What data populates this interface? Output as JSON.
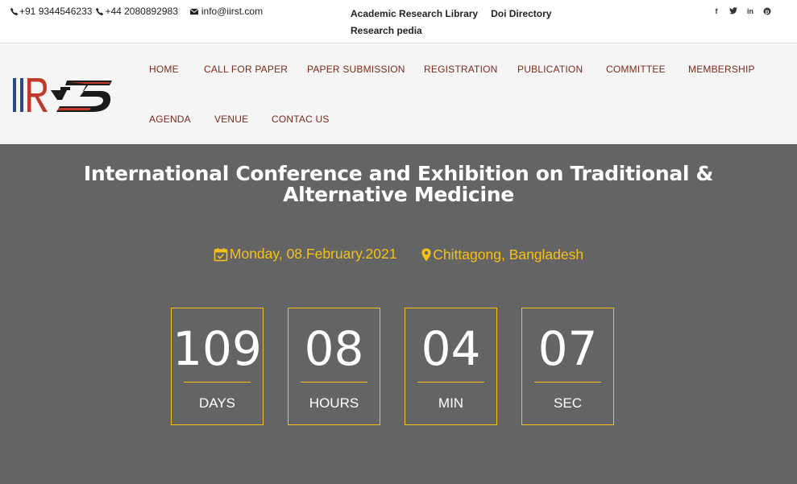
{
  "topbar": {
    "phone1": "+91 9344546233",
    "phone2": "+44 2080892983",
    "email": "info@iirst.com",
    "links": [
      "Academic Research Library",
      "Doi Directory",
      "Research pedia"
    ],
    "social": [
      "f",
      "t",
      "in",
      "p"
    ]
  },
  "nav": {
    "items": [
      "HOME",
      "CALL FOR PAPER",
      "PAPER SUBMISSION",
      "REGISTRATION",
      "PUBLICATION",
      "COMMITTEE",
      "MEMBERSHIP",
      "AGENDA",
      "VENUE",
      "CONTAC US"
    ]
  },
  "hero": {
    "title": "International Conference and Exhibition on Traditional & Alternative Medicine",
    "date": "Monday, 08.February.2021",
    "location": "Chittagong, Bangladesh",
    "countdown": [
      {
        "value": "109",
        "label": "DAYS"
      },
      {
        "value": "08",
        "label": "HOURS"
      },
      {
        "value": "04",
        "label": "MIN"
      },
      {
        "value": "07",
        "label": "SEC"
      }
    ]
  },
  "colors": {
    "accent": "#f5c116",
    "nav_text": "#7b2a1a",
    "hero_bg": "#646464",
    "header_bg": "#f5f5f5"
  }
}
